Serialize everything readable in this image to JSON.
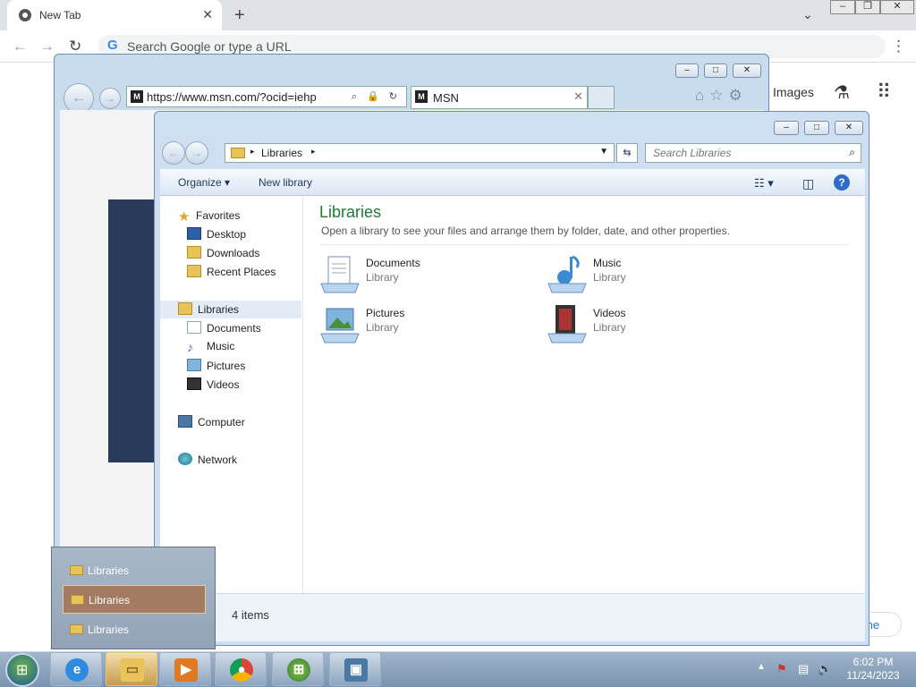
{
  "chrome": {
    "tab_title": "New Tab",
    "tab_close": "✕",
    "new_tab": "+",
    "omnibox_placeholder": "Search Google or type a URL",
    "images_link": "Images",
    "pill_text": "me"
  },
  "ie": {
    "url": "https://www.msn.com/?ocid=iehp",
    "tab_title": "MSN"
  },
  "explorer": {
    "breadcrumb": "Libraries",
    "search_placeholder": "Search Libraries",
    "toolbar": {
      "organize": "Organize",
      "new_library": "New library"
    },
    "nav": {
      "favorites": "Favorites",
      "desktop": "Desktop",
      "downloads": "Downloads",
      "recent_places": "Recent Places",
      "libraries": "Libraries",
      "documents": "Documents",
      "music": "Music",
      "pictures": "Pictures",
      "videos": "Videos",
      "computer": "Computer",
      "network": "Network"
    },
    "heading": "Libraries",
    "description": "Open a library to see your files and arrange them by folder, date, and other properties.",
    "libraries": [
      {
        "name": "Documents",
        "type": "Library"
      },
      {
        "name": "Music",
        "type": "Library"
      },
      {
        "name": "Pictures",
        "type": "Library"
      },
      {
        "name": "Videos",
        "type": "Library"
      }
    ],
    "status": "4 items"
  },
  "taskbar_popup": {
    "items": [
      "Libraries",
      "Libraries",
      "Libraries"
    ]
  },
  "clock": {
    "time": "6:02 PM",
    "date": "11/24/2023"
  }
}
